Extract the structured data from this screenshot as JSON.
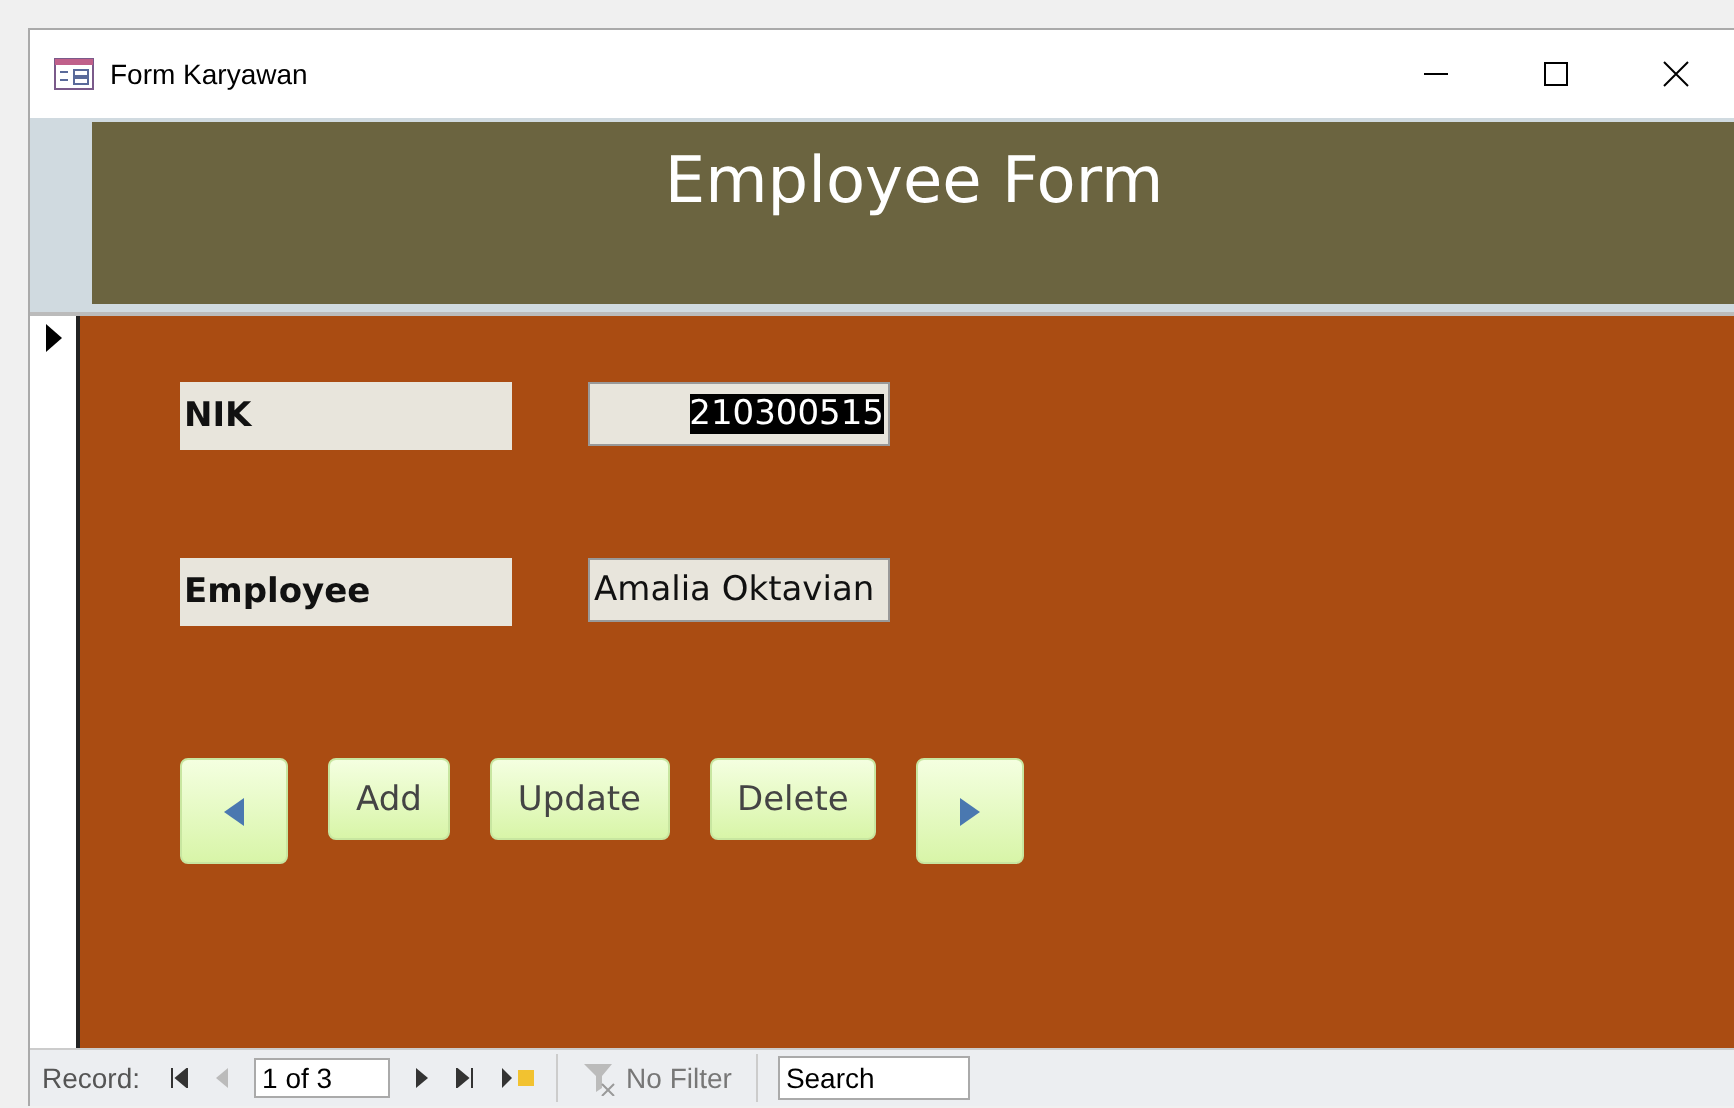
{
  "window": {
    "title": "Form Karyawan"
  },
  "header": {
    "title": "Employee Form"
  },
  "record_selector": {
    "current": true
  },
  "fields": [
    {
      "label": "NIK",
      "value": "210300515",
      "selected": true,
      "kind": "number"
    },
    {
      "label": "Employee",
      "value": "Amalia Oktavian",
      "selected": false,
      "kind": "text"
    }
  ],
  "buttons": [
    {
      "kind": "prev"
    },
    {
      "kind": "text",
      "label": "Add"
    },
    {
      "kind": "text",
      "label": "Update"
    },
    {
      "kind": "text",
      "label": "Delete"
    },
    {
      "kind": "next"
    }
  ],
  "navigation": {
    "label": "Record:",
    "record": "1 of 3",
    "filter": "No Filter",
    "search": {
      "placeholder": "Search"
    }
  }
}
